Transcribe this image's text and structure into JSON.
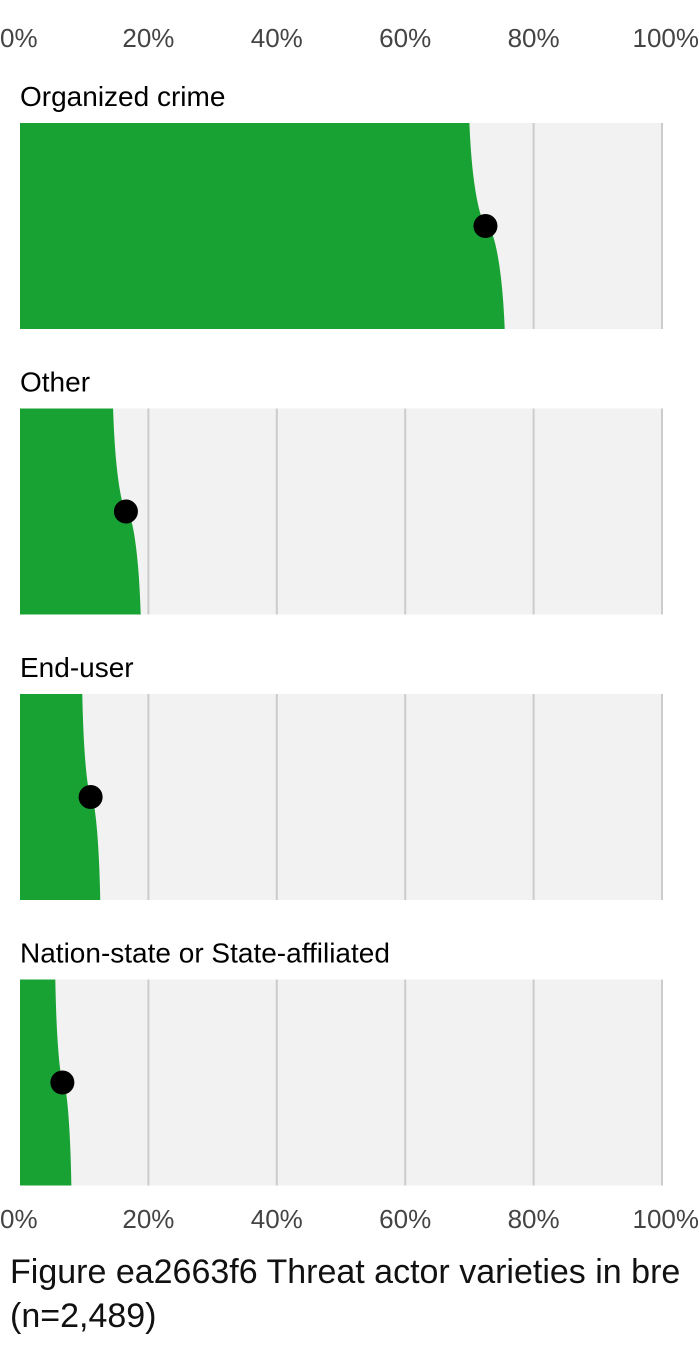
{
  "chart_data": {
    "type": "area",
    "subtype": "distribution-slabs-with-point-estimate",
    "xlabel": "",
    "ylabel": "",
    "xlim": [
      0,
      100
    ],
    "x_ticks": [
      "0%",
      "20%",
      "40%",
      "60%",
      "80%",
      "100%"
    ],
    "grid": true,
    "panels": [
      {
        "label": "Organized crime",
        "point": 72.5,
        "low": 70.0,
        "high": 75.5
      },
      {
        "label": "Other",
        "point": 16.5,
        "low": 14.5,
        "high": 18.8
      },
      {
        "label": "End-user",
        "point": 11.0,
        "low": 9.7,
        "high": 12.5
      },
      {
        "label": "Nation-state or State-affiliated",
        "point": 6.6,
        "low": 5.5,
        "high": 8.0
      }
    ]
  },
  "caption": {
    "line1": "Figure ea2663f6 Threat actor varieties in bre",
    "line2": "(n=2,489)"
  },
  "colors": {
    "fill": "#19a234",
    "panel_bg": "#f2f2f2",
    "grid": "#cccccc",
    "point": "#000000"
  }
}
